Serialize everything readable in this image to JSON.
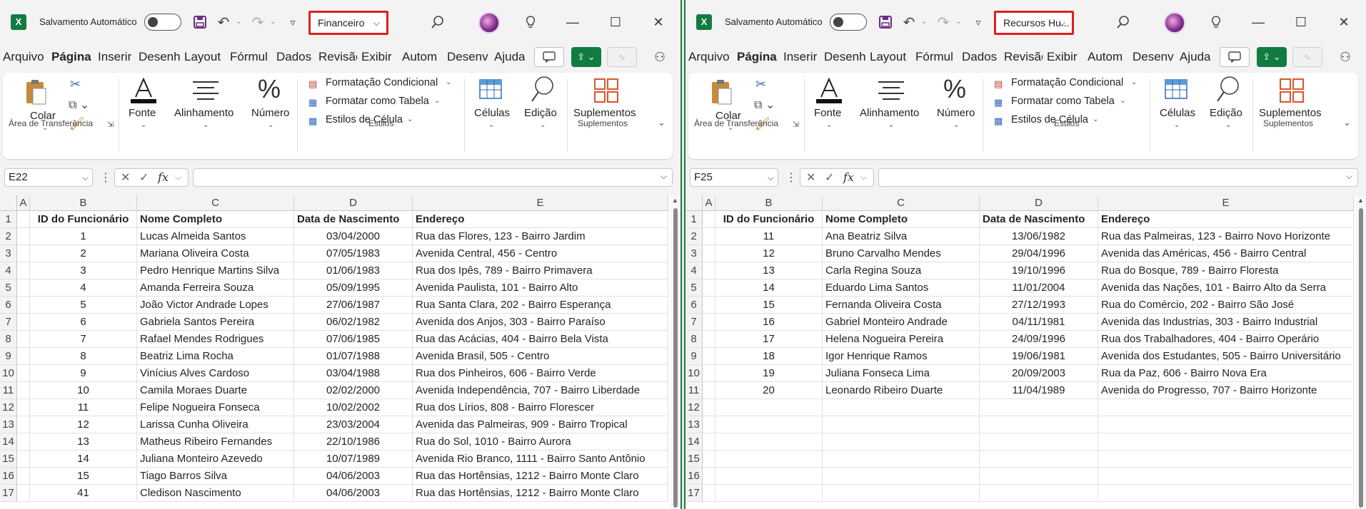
{
  "left": {
    "autosave_label": "Salvamento Automático",
    "filename": "Financeiro",
    "tabs": [
      "Arquivo",
      "Página",
      "Inserir",
      "Desenh",
      "Layout",
      "Fórmul",
      "Dados",
      "Revisão",
      "Exibir",
      "Autom",
      "Desenv",
      "Ajuda"
    ],
    "ribbon": {
      "paste": "Colar",
      "clipboard_group": "Área de Transferência",
      "font": "Fonte",
      "alignment": "Alinhamento",
      "number": "Número",
      "cond_format": "Formatação Condicional",
      "format_table": "Formatar como Tabela",
      "cell_styles": "Estilos de Célula",
      "styles_group": "Estilos",
      "cells": "Células",
      "editing": "Edição",
      "addins": "Suplementos",
      "addins_group": "Suplementos"
    },
    "namebox": "E22",
    "columns": [
      "A",
      "B",
      "C",
      "D",
      "E"
    ],
    "rows": [
      [
        "",
        "ID do Funcionário",
        "Nome Completo",
        "Data de Nascimento",
        "Endereço"
      ],
      [
        "",
        "1",
        "Lucas Almeida Santos",
        "03/04/2000",
        "Rua das Flores, 123 - Bairro Jardim"
      ],
      [
        "",
        "2",
        "Mariana Oliveira Costa",
        "07/05/1983",
        "Avenida Central, 456 - Centro"
      ],
      [
        "",
        "3",
        "Pedro Henrique Martins Silva",
        "01/06/1983",
        "Rua dos Ipês, 789 - Bairro Primavera"
      ],
      [
        "",
        "4",
        "Amanda Ferreira Souza",
        "05/09/1995",
        "Avenida Paulista, 101 - Bairro Alto"
      ],
      [
        "",
        "5",
        "João Victor Andrade Lopes",
        "27/06/1987",
        "Rua Santa Clara, 202 - Bairro Esperança"
      ],
      [
        "",
        "6",
        "Gabriela Santos Pereira",
        "06/02/1982",
        "Avenida dos Anjos, 303 - Bairro Paraíso"
      ],
      [
        "",
        "7",
        "Rafael Mendes Rodrigues",
        "07/06/1985",
        "Rua das Acácias, 404 - Bairro Bela Vista"
      ],
      [
        "",
        "8",
        "Beatriz Lima Rocha",
        "01/07/1988",
        "Avenida Brasil, 505 - Centro"
      ],
      [
        "",
        "9",
        "Vinícius Alves Cardoso",
        "03/04/1988",
        "Rua dos Pinheiros, 606 - Bairro Verde"
      ],
      [
        "",
        "10",
        "Camila Moraes Duarte",
        "02/02/2000",
        "Avenida Independência, 707 - Bairro Liberdade"
      ],
      [
        "",
        "11",
        "Felipe Nogueira Fonseca",
        "10/02/2002",
        "Rua dos Lírios, 808 - Bairro Florescer"
      ],
      [
        "",
        "12",
        "Larissa Cunha Oliveira",
        "23/03/2004",
        "Avenida das Palmeiras, 909 - Bairro Tropical"
      ],
      [
        "",
        "13",
        "Matheus Ribeiro Fernandes",
        "22/10/1986",
        "Rua do Sol, 1010 - Bairro Aurora"
      ],
      [
        "",
        "14",
        "Juliana Monteiro Azevedo",
        "10/07/1989",
        "Avenida Rio Branco, 1111 - Bairro Santo Antônio"
      ],
      [
        "",
        "15",
        "Tiago Barros Silva",
        "04/06/2003",
        "Rua das Hortênsias, 1212 - Bairro Monte Claro"
      ],
      [
        "",
        "41",
        "Cledison Nascimento",
        "04/06/2003",
        "Rua das Hortênsias, 1212 - Bairro Monte Claro"
      ]
    ]
  },
  "right": {
    "autosave_label": "Salvamento Automático",
    "filename": "Recursos Hu...",
    "tabs": [
      "Arquivo",
      "Página",
      "Inserir",
      "Desenh",
      "Layout",
      "Fórmul",
      "Dados",
      "Revisão",
      "Exibir",
      "Autom",
      "Desenv",
      "Ajuda"
    ],
    "ribbon": {
      "paste": "Colar",
      "clipboard_group": "Área de Transferência",
      "font": "Fonte",
      "alignment": "Alinhamento",
      "number": "Número",
      "cond_format": "Formatação Condicional",
      "format_table": "Formatar como Tabela",
      "cell_styles": "Estilos de Célula",
      "styles_group": "Estilos",
      "cells": "Células",
      "editing": "Edição",
      "addins": "Suplementos",
      "addins_group": "Suplementos"
    },
    "namebox": "F25",
    "columns": [
      "A",
      "B",
      "C",
      "D",
      "E"
    ],
    "rows": [
      [
        "",
        "ID do Funcionário",
        "Nome Completo",
        "Data de Nascimento",
        "Endereço"
      ],
      [
        "",
        "11",
        "Ana Beatriz Silva",
        "13/06/1982",
        "Rua das Palmeiras, 123 - Bairro Novo Horizonte"
      ],
      [
        "",
        "12",
        "Bruno Carvalho Mendes",
        "29/04/1996",
        "Avenida das Américas, 456 - Bairro Central"
      ],
      [
        "",
        "13",
        "Carla Regina Souza",
        "19/10/1996",
        "Rua do Bosque, 789 - Bairro Floresta"
      ],
      [
        "",
        "14",
        "Eduardo Lima Santos",
        "11/01/2004",
        "Avenida das Nações, 101 - Bairro Alto da Serra"
      ],
      [
        "",
        "15",
        "Fernanda Oliveira Costa",
        "27/12/1993",
        "Rua do Comércio, 202 - Bairro São José"
      ],
      [
        "",
        "16",
        "Gabriel Monteiro Andrade",
        "04/11/1981",
        "Avenida das Industrias, 303 - Bairro Industrial"
      ],
      [
        "",
        "17",
        "Helena Nogueira Pereira",
        "24/09/1996",
        "Rua dos Trabalhadores, 404 - Bairro Operário"
      ],
      [
        "",
        "18",
        "Igor Henrique Ramos",
        "19/06/1981",
        "Avenida dos Estudantes, 505 - Bairro Universitário"
      ],
      [
        "",
        "19",
        "Juliana Fonseca Lima",
        "20/09/2003",
        "Rua da Paz, 606 - Bairro Nova Era"
      ],
      [
        "",
        "20",
        "Leonardo Ribeiro Duarte",
        "11/04/1989",
        "Avenida do Progresso, 707 - Bairro Horizonte"
      ],
      [
        "",
        "",
        "",
        "",
        ""
      ],
      [
        "",
        "",
        "",
        "",
        ""
      ],
      [
        "",
        "",
        "",
        "",
        ""
      ],
      [
        "",
        "",
        "",
        "",
        ""
      ],
      [
        "",
        "",
        "",
        "",
        ""
      ],
      [
        "",
        "",
        "",
        "",
        ""
      ]
    ]
  },
  "row_numbers": [
    "1",
    "2",
    "3",
    "4",
    "5",
    "6",
    "7",
    "8",
    "9",
    "10",
    "11",
    "12",
    "13",
    "14",
    "15",
    "16",
    "17"
  ],
  "colors": {
    "accent": "#107c41",
    "highlight_border": "#e02020"
  }
}
